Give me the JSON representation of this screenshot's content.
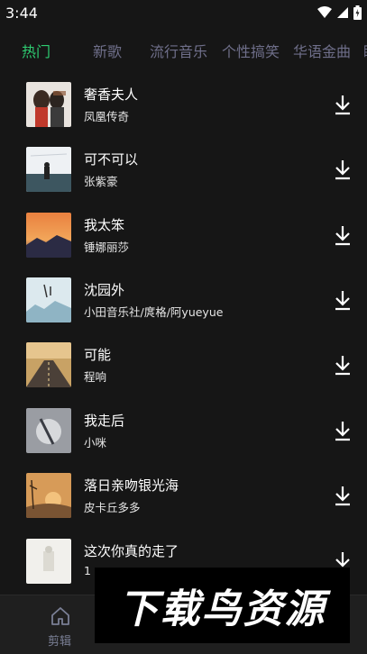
{
  "status": {
    "time": "3:44"
  },
  "tabs": [
    "热门",
    "新歌",
    "流行音乐",
    "个性搞笑",
    "华语金曲",
    "睡"
  ],
  "songs": [
    {
      "title": "奢香夫人",
      "artist": "凤凰传奇"
    },
    {
      "title": "可不可以",
      "artist": "张紫豪"
    },
    {
      "title": "我太笨",
      "artist": "锤娜丽莎"
    },
    {
      "title": "沈园外",
      "artist": "小田音乐社/庹格/阿yueyue"
    },
    {
      "title": "可能",
      "artist": "程响"
    },
    {
      "title": "我走后",
      "artist": "小咪"
    },
    {
      "title": "落日亲吻银光海",
      "artist": "皮卡丘多多"
    },
    {
      "title": "这次你真的走了",
      "artist": "1"
    }
  ],
  "nav": {
    "home_label": "剪辑"
  },
  "watermark": {
    "text": "下载鸟资源"
  },
  "colors": {
    "accent": "#2ecc71",
    "background": "#161616"
  }
}
